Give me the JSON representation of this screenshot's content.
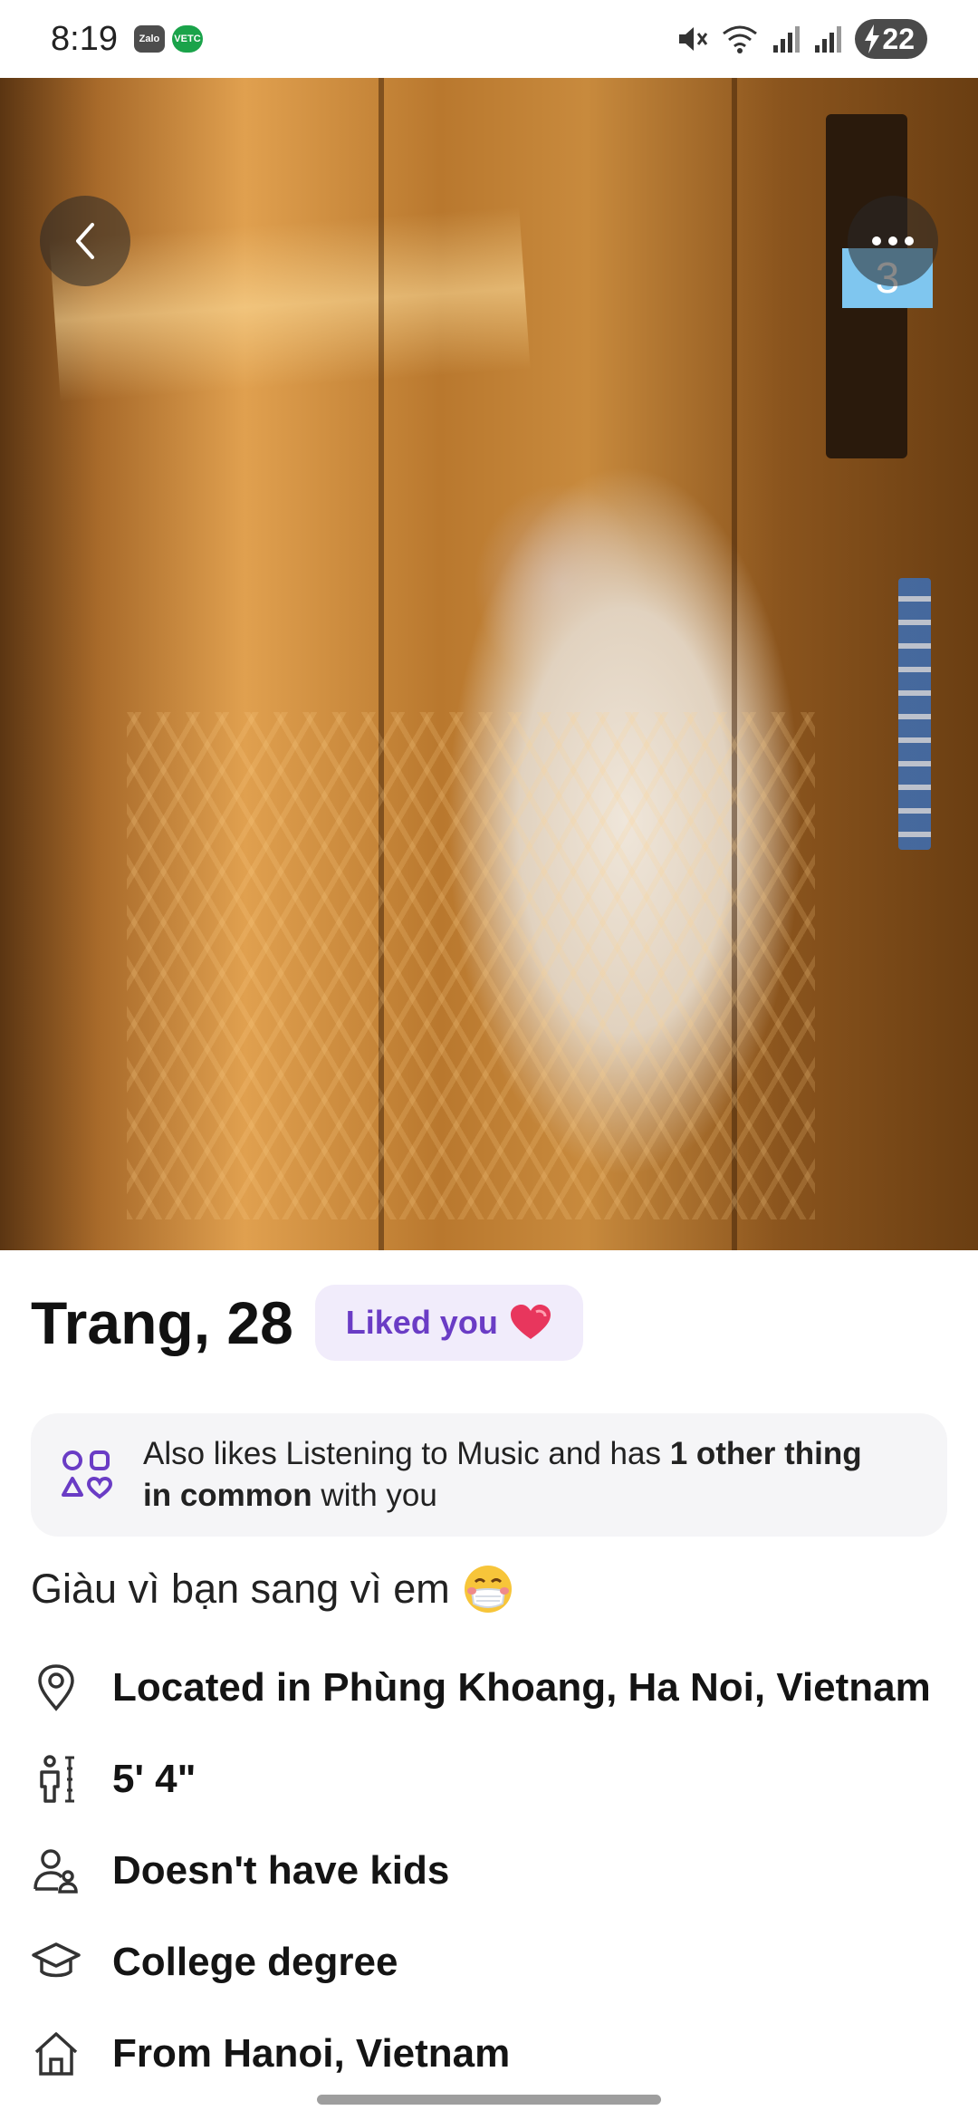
{
  "status_bar": {
    "time": "8:19",
    "apps": [
      "Zalo",
      "VETC"
    ],
    "battery": "22"
  },
  "photo": {
    "floor_number": "3"
  },
  "profile": {
    "name_age": "Trang, 28",
    "liked_label": "Liked you",
    "common": {
      "prefix": "Also likes Listening to Music and has ",
      "bold1": "1 other thing",
      "newline_bold": "in common",
      "suffix": " with you"
    },
    "bio": "Giàu vì bạn sang vì em",
    "details": [
      {
        "icon": "location-pin-icon",
        "text": "Located in Phùng Khoang, Ha Noi, Vietnam"
      },
      {
        "icon": "height-icon",
        "text": "5' 4\""
      },
      {
        "icon": "kids-icon",
        "text": "Doesn't have kids"
      },
      {
        "icon": "graduation-cap-icon",
        "text": "College degree"
      },
      {
        "icon": "home-icon",
        "text": "From Hanoi, Vietnam"
      }
    ]
  },
  "colors": {
    "accent": "#6a3cc5",
    "pill_bg": "#f1ecfb"
  }
}
